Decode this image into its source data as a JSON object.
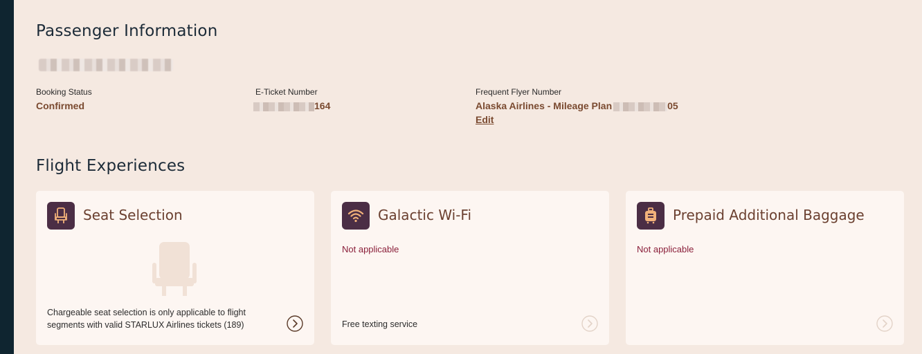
{
  "passenger_section": {
    "title": "Passenger Information",
    "booking_status": {
      "label": "Booking Status",
      "value": "Confirmed"
    },
    "eticket": {
      "label": "E-Ticket Number",
      "value_suffix": "164"
    },
    "frequent_flyer": {
      "label": "Frequent Flyer Number",
      "value_prefix": "Alaska Airlines - Mileage Plan",
      "value_suffix": "05",
      "edit_label": "Edit"
    }
  },
  "experiences_section": {
    "title": "Flight Experiences",
    "cards": [
      {
        "title": "Seat Selection",
        "icon": "seat-icon",
        "description": "Chargeable seat selection is only applicable to flight segments with valid STARLUX Airlines tickets (189)",
        "arrow_enabled": true
      },
      {
        "title": "Galactic Wi-Fi",
        "icon": "wifi-icon",
        "note": "Not applicable",
        "description": "Free texting service",
        "arrow_enabled": false
      },
      {
        "title": "Prepaid Additional Baggage",
        "icon": "baggage-icon",
        "note": "Not applicable",
        "arrow_enabled": false
      }
    ]
  },
  "colors": {
    "background": "#f5e9e1",
    "card": "#fdf6f2",
    "icon_tile": "#4b2e45",
    "icon_accent": "#f2b27a",
    "value_text": "#7a4a30",
    "note_text": "#8a1f3a",
    "left_rail": "#0f2530"
  }
}
